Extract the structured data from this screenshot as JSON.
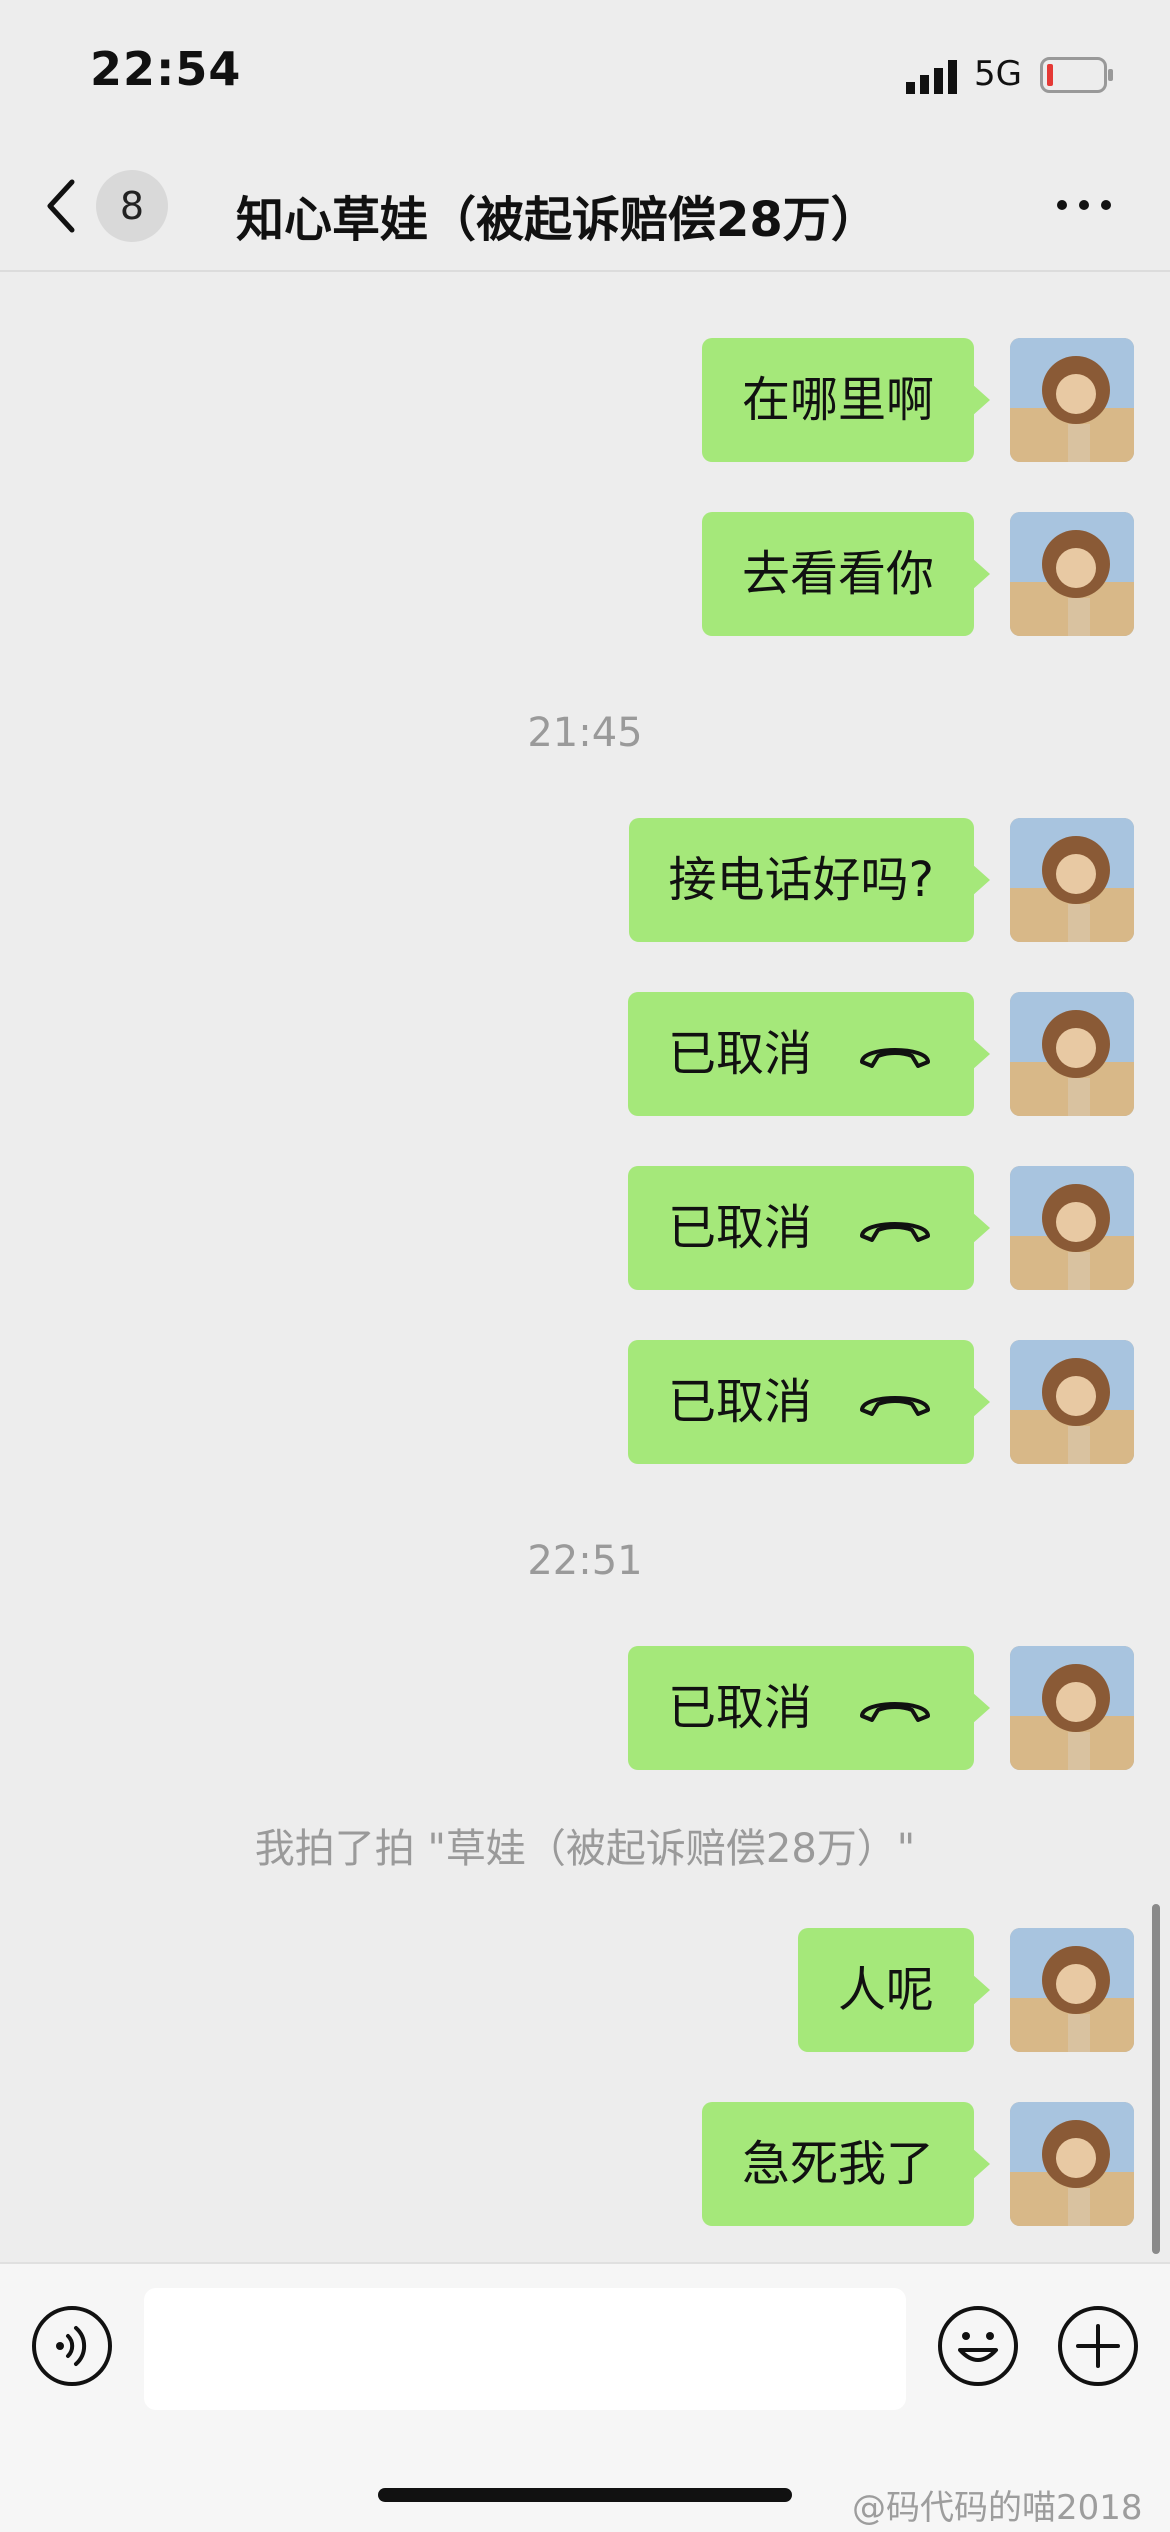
{
  "status_bar": {
    "time": "22:54",
    "network": "5G",
    "battery_color": "#e53935"
  },
  "nav": {
    "badge_count": "8",
    "title": "知心草娃（被起诉赔偿28万）"
  },
  "messages": {
    "m1": "在哪里啊",
    "m2": "去看看你",
    "ts1": "21:45",
    "m3": "接电话好吗?",
    "c1": "已取消",
    "c2": "已取消",
    "c3": "已取消",
    "ts2": "22:51",
    "c4": "已取消",
    "system_note": "我拍了拍 \"草娃（被起诉赔偿28万）\"",
    "m4": "人呢",
    "m5": "急死我了"
  },
  "input": {
    "placeholder": "",
    "value": ""
  },
  "watermark": "@码代码的喵2018",
  "colors": {
    "bubble": "#a5e87a",
    "background": "#ededed"
  }
}
